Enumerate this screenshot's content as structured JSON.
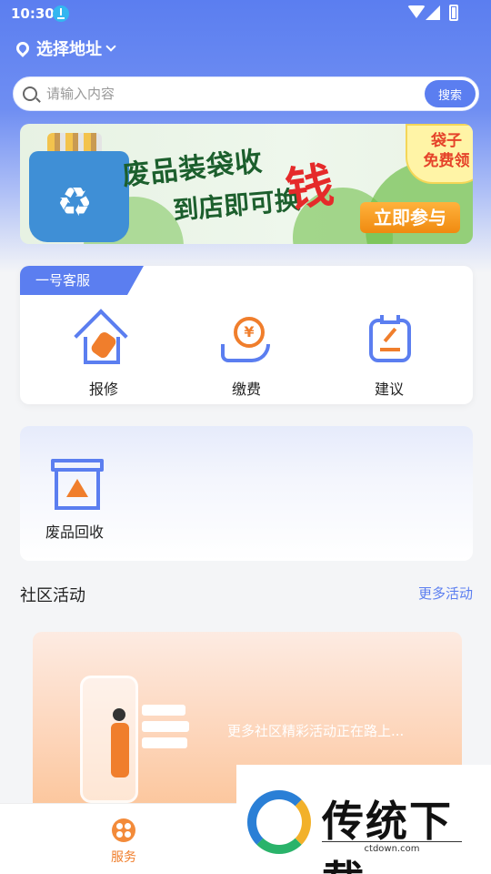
{
  "status_bar": {
    "time": "10:30"
  },
  "header": {
    "address_label": "选择地址"
  },
  "search": {
    "placeholder": "请输入内容",
    "button_label": "搜索"
  },
  "banner": {
    "line1": "废品装袋收",
    "line2": "到店即可换",
    "money": "钱",
    "cta": "立即参与",
    "badge_line1": "袋子",
    "badge_line2": "免费领"
  },
  "service_card": {
    "tag": "一号客服",
    "items": [
      {
        "label": "报修",
        "icon": "house-wrench-icon"
      },
      {
        "label": "缴费",
        "icon": "coin-hand-icon"
      },
      {
        "label": "建议",
        "icon": "clipboard-pen-icon"
      }
    ]
  },
  "recycle_card": {
    "label": "废品回收",
    "icon": "recycle-box-icon"
  },
  "activities": {
    "title": "社区活动",
    "more": "更多活动",
    "placeholder_text": "更多社区精彩活动正在路上..."
  },
  "bottom_nav": {
    "items": [
      {
        "label": "服务",
        "icon": "service-grid-icon",
        "active": true
      }
    ]
  },
  "watermark": {
    "title": "传统下载",
    "url": "ctdown.com"
  },
  "colors": {
    "primary": "#5b7ef0",
    "accent": "#f07e2c"
  }
}
